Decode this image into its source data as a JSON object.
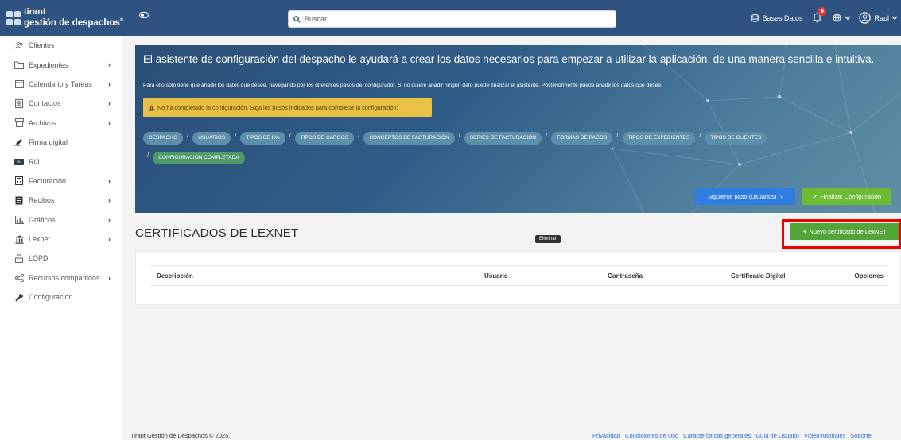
{
  "header": {
    "logo_line1": "tirant",
    "logo_line2": "gestión de despachos",
    "logo_reg": "®",
    "search_placeholder": "Buscar",
    "db_label": "Bases Datos",
    "notif_count": "9",
    "user_name": "Raul"
  },
  "sidebar": {
    "items": [
      {
        "label": "Clientes",
        "icon": "users-icon",
        "chevron": false
      },
      {
        "label": "Expedientes",
        "icon": "folder-icon",
        "chevron": true
      },
      {
        "label": "Calendario y Tareas",
        "icon": "calendar-icon",
        "chevron": true
      },
      {
        "label": "Contactos",
        "icon": "contacts-icon",
        "chevron": true
      },
      {
        "label": "Archivos",
        "icon": "archive-icon",
        "chevron": true
      },
      {
        "label": "Firma digital",
        "icon": "signature-icon",
        "chevron": false
      },
      {
        "label": "RIJ",
        "icon": "rij-icon",
        "chevron": false
      },
      {
        "label": "Facturación",
        "icon": "calculator-icon",
        "chevron": true
      },
      {
        "label": "Recibos",
        "icon": "receipt-icon",
        "chevron": true
      },
      {
        "label": "Gráficos",
        "icon": "chart-icon",
        "chevron": true
      },
      {
        "label": "Lexnet",
        "icon": "bank-icon",
        "chevron": true
      },
      {
        "label": "LOPD",
        "icon": "lock-icon",
        "chevron": false
      },
      {
        "label": "Recursos compartidos",
        "icon": "share-icon",
        "chevron": true
      },
      {
        "label": "Configuración",
        "icon": "wrench-icon",
        "chevron": false
      }
    ],
    "chevron_glyph": "›"
  },
  "banner": {
    "title": "El asistente de configuración del despacho le ayudará a crear los datos necesarios para empezar a utilizar la aplicación, de una manera sencilla e intuitiva.",
    "subtitle": "Para ello sólo tiene que añadir los datos que desee, navegando por los diferentes pasos del configurador. Si no quiere añadir ningún dato puede finalizar el asistente. Posteriormente puede añadir los datos que desee.",
    "warning": "No ha completado la configuración. Siga los pasos indicados para completar la configuración:",
    "steps_row1": [
      "DESPACHO",
      "USUARIOS",
      "TIPOS DE IVA",
      "TIPOS DE CARGOS",
      "CONCEPTOS DE FACTURACIÓN",
      "SERIES DE FACTURACIÓN",
      "FORMAS DE PAGOS",
      "TIPOS DE EXPEDIENTES",
      "TIPOS DE CLIENTES"
    ],
    "step_final": "CONFIGURACIÓN COMPLETADA",
    "next_button": "Siguiente paso (Usuarios)",
    "next_arrow": "›",
    "finish_button": "Finalizar Configuración",
    "finish_check": "✔"
  },
  "section": {
    "title": "CERTIFICADOS DE LEXNET",
    "tooltip": "Eliminar",
    "new_button": "Nuevo certificado de LexNET",
    "new_plus": "+"
  },
  "table": {
    "columns": [
      "Descripción",
      "Usuario",
      "Contraseña",
      "Certificado Digital",
      "Opciones"
    ]
  },
  "footer": {
    "copyright": "Tirant Gestión de Despachos © 2025.",
    "links": [
      "Privacidad",
      "Condiciones de Uso",
      "Características generales",
      "Guía de Usuario",
      "Vídeo-tutoriales",
      "Soporte"
    ]
  },
  "colors": {
    "topbar": "#2f5380",
    "accent_green": "#53a53a",
    "accent_blue": "#2f7de0",
    "warning": "#e9c046",
    "highlight": "#ee0000"
  }
}
